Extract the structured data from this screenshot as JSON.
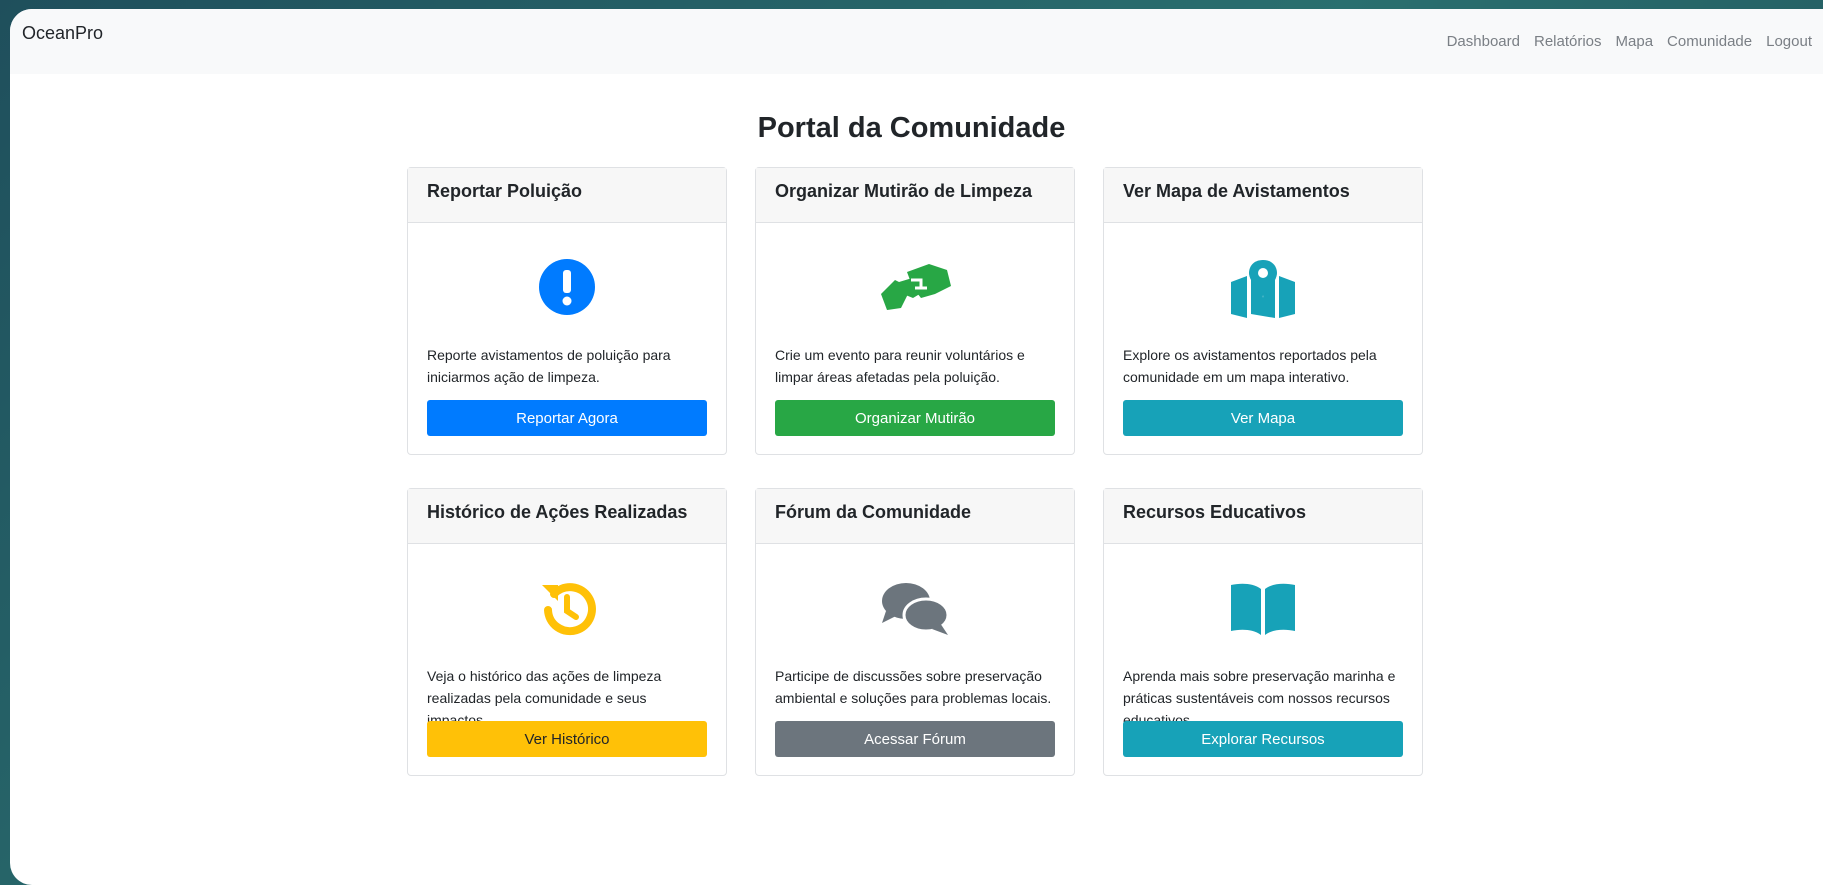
{
  "navbar": {
    "brand": "OceanPro",
    "links": [
      "Dashboard",
      "Relatórios",
      "Mapa",
      "Comunidade",
      "Logout"
    ]
  },
  "page_title": "Portal da Comunidade",
  "cards": [
    {
      "title": "Reportar Poluição",
      "icon": "exclamation-circle-icon",
      "icon_color": "#007bff",
      "text": "Reporte avistamentos de poluição para iniciarmos ação de limpeza.",
      "button": "Reportar Agora",
      "button_color": "#007bff"
    },
    {
      "title": "Organizar Mutirão de Limpeza",
      "icon": "handshake-icon",
      "icon_color": "#28a745",
      "text": "Crie um evento para reunir voluntários e limpar áreas afetadas pela poluição.",
      "button": "Organizar Mutirão",
      "button_color": "#28a745"
    },
    {
      "title": "Ver Mapa de Avistamentos",
      "icon": "map-marked-icon",
      "icon_color": "#17a2b8",
      "text": "Explore os avistamentos reportados pela comunidade em um mapa interativo.",
      "button": "Ver Mapa",
      "button_color": "#17a2b8"
    },
    {
      "title": "Histórico de Ações Realizadas",
      "icon": "history-icon",
      "icon_color": "#ffc107",
      "text": "Veja o histórico das ações de limpeza realizadas pela comunidade e seus impactos.",
      "button": "Ver Histórico",
      "button_color": "#ffc107"
    },
    {
      "title": "Fórum da Comunidade",
      "icon": "comments-icon",
      "icon_color": "#6c757d",
      "text": "Participe de discussões sobre preservação ambiental e soluções para problemas locais.",
      "button": "Acessar Fórum",
      "button_color": "#6c757d"
    },
    {
      "title": "Recursos Educativos",
      "icon": "book-open-icon",
      "icon_color": "#17a2b8",
      "text": "Aprenda mais sobre preservação marinha e práticas sustentáveis com nossos recursos educativos.",
      "button": "Explorar Recursos",
      "button_color": "#17a2b8"
    }
  ]
}
